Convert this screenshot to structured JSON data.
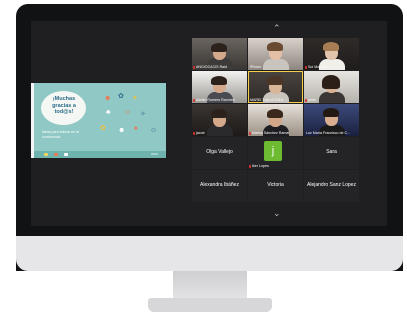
{
  "slide": {
    "title": "¡Muchas gracias a tod@s!",
    "subtitle": "Ideas para educar en la convivencia",
    "footer": "2020"
  },
  "gallery": {
    "scroll_up_icon": "chevron-up-icon",
    "scroll_down_icon": "chevron-down-icon",
    "tiles": [
      {
        "name": "ANGIOCACIS Raid",
        "type": "video"
      },
      {
        "name": "iPhone",
        "type": "video"
      },
      {
        "name": "Sol Morcillo",
        "type": "video"
      },
      {
        "name": "Adrián Romero Ramírez",
        "type": "video"
      },
      {
        "name": "MAREI 3 sin el 2019",
        "type": "video"
      },
      {
        "name": "pella",
        "type": "video"
      },
      {
        "name": "jacob",
        "type": "video"
      },
      {
        "name": "Marisa Sánchez Ramal",
        "type": "video"
      },
      {
        "name": "Luz María Francisco de C...",
        "type": "video"
      },
      {
        "name": "Olga Vallejo",
        "type": "name"
      },
      {
        "name": "Iker Lopes",
        "type": "avatar",
        "initial": "j"
      },
      {
        "name": "Sara",
        "type": "name"
      },
      {
        "name": "Alexandra Ibáñez",
        "type": "name"
      },
      {
        "name": "Victoria",
        "type": "name"
      },
      {
        "name": "Alejandro Sanz Lopez",
        "type": "name"
      }
    ]
  },
  "colors": {
    "slide_bg": "#8fc8c4",
    "active_speaker": "#f5d14a",
    "mute_red": "#e0312b"
  }
}
